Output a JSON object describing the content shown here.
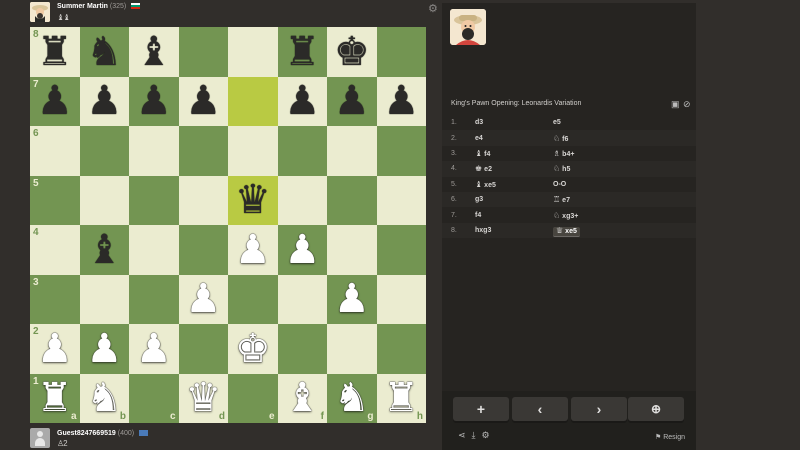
{
  "top_player": {
    "name": "Summer Martin",
    "rating": "(325)",
    "captured": "♝♝"
  },
  "bottom_player": {
    "name": "Guest8247669519",
    "rating": "(400)",
    "captured": "♙2"
  },
  "board": {
    "highlight": [
      "e7",
      "e5"
    ],
    "ranks": [
      "8",
      "7",
      "6",
      "5",
      "4",
      "3",
      "2",
      "1"
    ],
    "files": [
      "a",
      "b",
      "c",
      "d",
      "e",
      "f",
      "g",
      "h"
    ],
    "pieces": {
      "a8": "br",
      "b8": "bn",
      "c8": "bb",
      "f8": "br",
      "g8": "bk",
      "a7": "bp",
      "b7": "bp",
      "c7": "bp",
      "d7": "bp",
      "f7": "bp",
      "g7": "bp",
      "h7": "bp",
      "e5": "bq",
      "b4": "bb",
      "e4": "wp",
      "f4": "wp",
      "d3": "wp",
      "g3": "wp",
      "a2": "wp",
      "b2": "wp",
      "c2": "wp",
      "e2": "wk",
      "a1": "wr",
      "b1": "wn",
      "d1": "wq",
      "f1": "wb",
      "g1": "wn",
      "h1": "wr"
    }
  },
  "panel": {
    "opening": "King's Pawn Opening: Leonardis Variation",
    "moves": [
      {
        "n": "1.",
        "w": "d3",
        "wp": "",
        "b": "e5",
        "bp": ""
      },
      {
        "n": "2.",
        "w": "e4",
        "wp": "",
        "b": "f6",
        "bp": "♘"
      },
      {
        "n": "3.",
        "w": "f4",
        "wp": "♝",
        "b": "b4+",
        "bp": "♗"
      },
      {
        "n": "4.",
        "w": "e2",
        "wp": "♚",
        "b": "h5",
        "bp": "♘"
      },
      {
        "n": "5.",
        "w": "xe5",
        "wp": "♝",
        "b": "O-O",
        "bp": ""
      },
      {
        "n": "6.",
        "w": "g3",
        "wp": "",
        "b": "e7",
        "bp": "♖"
      },
      {
        "n": "7.",
        "w": "f4",
        "wp": "",
        "b": "xg3+",
        "bp": "♘"
      },
      {
        "n": "8.",
        "w": "hxg3",
        "wp": "",
        "b": "xe5",
        "bp": "♕"
      }
    ],
    "controls": [
      "+",
      "‹",
      "›",
      "⊕"
    ],
    "resign": "Resign"
  }
}
